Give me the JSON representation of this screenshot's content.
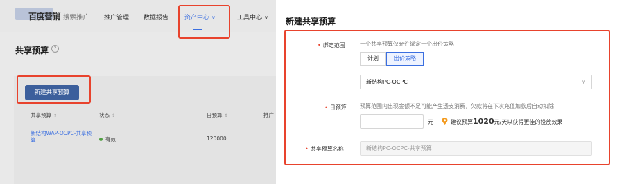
{
  "topnav": {
    "logo": "百度营销",
    "logo_sub": "搜索推广",
    "items": [
      "推广管理",
      "数据报告",
      "资产中心",
      "工具中心"
    ],
    "active": "资产中心"
  },
  "page": {
    "title": "共享预算",
    "create_button": "新建共享预算",
    "table": {
      "headers": [
        "共享预算",
        "状态",
        "日预算",
        "推广"
      ],
      "row": {
        "name": "新结构WAP-OCPC-共享预算",
        "status": "有效",
        "daily_budget": "120000"
      }
    }
  },
  "modal": {
    "title": "新建共享预算",
    "bind_scope": {
      "label": "绑定范围",
      "hint": "一个共享预算仅允许绑定一个出价策略",
      "options": [
        "计划",
        "出价策略"
      ],
      "selected": "出价策略",
      "select_value": "新结构PC-OCPC"
    },
    "daily_budget": {
      "label": "日预算",
      "hint": "预算范围内出现金额不足可能产生透支消费，欠款将在下次充值加款后自动扣除",
      "unit": "元",
      "suggest_prefix": "建议预算",
      "suggest_amount": "1020",
      "suggest_suffix": "元/天以获得更佳的投放效果"
    },
    "name": {
      "label": "共享预算名称",
      "placeholder": "新结构PC-OCPC-共享预算"
    }
  },
  "colors": {
    "accent": "#3b6fe0",
    "highlight": "#e8432d",
    "status_green": "#52a043",
    "pin": "#f39a1e"
  }
}
